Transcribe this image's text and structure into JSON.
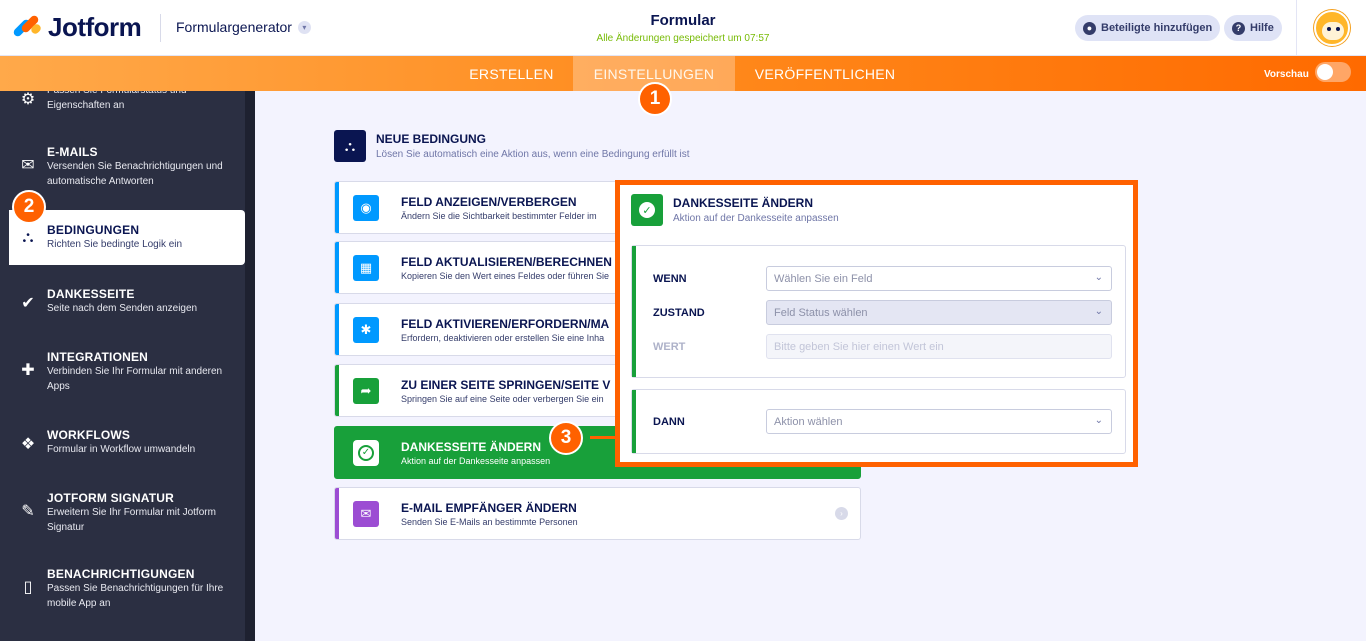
{
  "header": {
    "brand": "Jotform",
    "form_generator": "Formulargenerator",
    "form_title": "Formular",
    "save_status": "Alle Änderungen gespeichert um 07:57",
    "add_participants": "Beteiligte hinzufügen",
    "help": "Hilfe"
  },
  "nav": {
    "tabs": [
      "ERSTELLEN",
      "EINSTELLUNGEN",
      "VERÖFFENTLICHEN"
    ],
    "active_tab": "EINSTELLUNGEN",
    "preview_label": "Vorschau"
  },
  "sidebar": {
    "items": [
      {
        "title": "",
        "desc": "Passen Sie Formularstatus und Eigenschaften an",
        "icon": "gear-icon"
      },
      {
        "title": "E-MAILS",
        "desc": "Versenden Sie Benachrichtigungen und automatische Antworten",
        "icon": "envelope-icon"
      },
      {
        "title": "BEDINGUNGEN",
        "desc": "Richten Sie bedingte Logik ein",
        "icon": "hierarchy-icon"
      },
      {
        "title": "DANKESSEITE",
        "desc": "Seite nach dem Senden anzeigen",
        "icon": "check-circle-icon"
      },
      {
        "title": "INTEGRATIONEN",
        "desc": "Verbinden Sie Ihr Formular mit anderen Apps",
        "icon": "puzzle-icon"
      },
      {
        "title": "WORKFLOWS",
        "desc": "Formular in Workflow umwandeln",
        "icon": "workflow-icon"
      },
      {
        "title": "JOTFORM SIGNATUR",
        "desc": "Erweitern Sie Ihr Formular mit Jotform Signatur",
        "icon": "pen-icon"
      },
      {
        "title": "BENACHRICHTIGUNGEN",
        "desc": "Passen Sie Benachrichtigungen für Ihre mobile App an",
        "icon": "mobile-icon"
      }
    ]
  },
  "condition": {
    "title": "NEUE BEDINGUNG",
    "desc": "Lösen Sie automatisch eine Aktion aus, wenn eine Bedingung erfüllt ist"
  },
  "cards": [
    {
      "title": "FELD ANZEIGEN/VERBERGEN",
      "desc": "Ändern Sie die Sichtbarkeit bestimmter Felder im",
      "color": "#0099ff",
      "icon": "eye-icon"
    },
    {
      "title": "FELD AKTUALISIEREN/BERECHNEN",
      "desc": "Kopieren Sie den Wert eines Feldes oder führen Sie",
      "color": "#0099ff",
      "icon": "calculator-icon"
    },
    {
      "title": "FELD AKTIVIEREN/ERFORDERN/MA",
      "desc": "Erfordern, deaktivieren oder erstellen Sie eine Inha",
      "color": "#0099ff",
      "icon": "asterisk-icon"
    },
    {
      "title": "ZU EINER SEITE SPRINGEN/SEITE V",
      "desc": "Springen Sie auf eine Seite oder verbergen Sie ein",
      "color": "#18a03a",
      "icon": "share-arrow-icon"
    },
    {
      "title": "DANKESSEITE ÄNDERN",
      "desc": "Aktion auf der Dankesseite anpassen",
      "color": "#18a03a",
      "icon": "check-icon"
    },
    {
      "title": "E-MAIL EMPFÄNGER ÄNDERN",
      "desc": "Senden Sie E-Mails an bestimmte Personen",
      "color": "#9c4dd3",
      "icon": "mail-icon"
    }
  ],
  "panel": {
    "title": "DANKESSEITE ÄNDERN",
    "desc": "Aktion auf der Dankesseite anpassen",
    "if_label": "WENN",
    "if_placeholder": "Wählen Sie ein Feld",
    "state_label": "ZUSTAND",
    "state_placeholder": "Feld Status wählen",
    "value_label": "WERT",
    "value_placeholder": "Bitte geben Sie hier einen Wert ein",
    "then_label": "DANN",
    "then_placeholder": "Aktion wählen"
  },
  "badges": [
    "1",
    "2",
    "3"
  ]
}
